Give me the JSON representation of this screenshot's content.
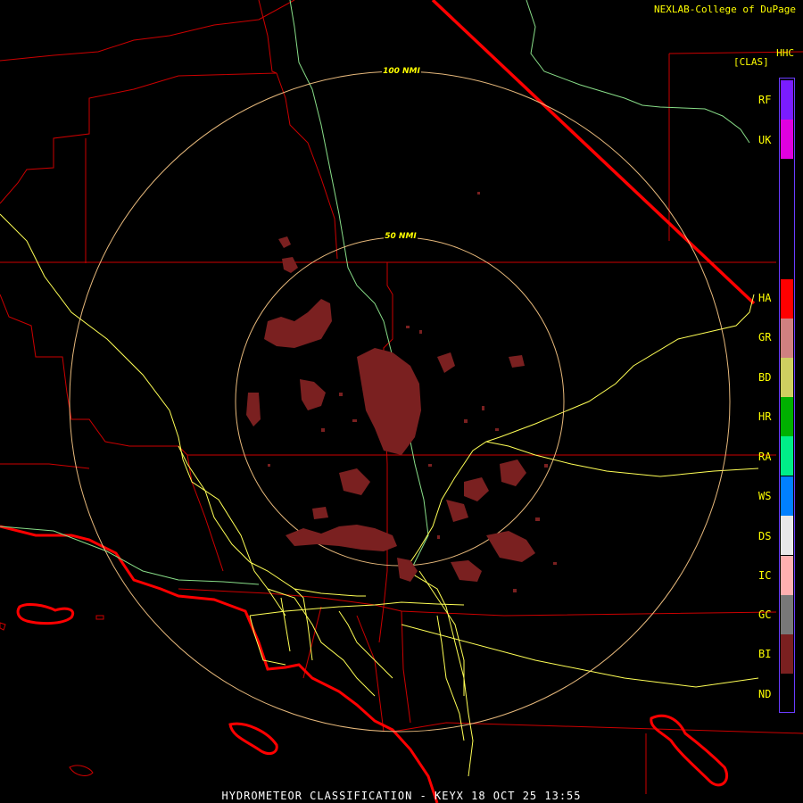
{
  "credit": "NEXLAB-College of DuPage",
  "product": {
    "code": "HHC",
    "sub": "[CLAS]"
  },
  "footer": "HYDROMETEOR CLASSIFICATION - KEYX 18 OCT 25 13:55",
  "rings": [
    {
      "label": "50 NMI"
    },
    {
      "label": "100 NMI"
    }
  ],
  "legend": [
    {
      "code": "RF",
      "color": "#7a1cff"
    },
    {
      "code": "UK",
      "color": "#e000e0"
    },
    {
      "code": "HA",
      "color": "#ff0000"
    },
    {
      "code": "GR",
      "color": "#d08080"
    },
    {
      "code": "BD",
      "color": "#cfcf60"
    },
    {
      "code": "HR",
      "color": "#00b000"
    },
    {
      "code": "RA",
      "color": "#00ee88"
    },
    {
      "code": "WS",
      "color": "#0080ff"
    },
    {
      "code": "DS",
      "color": "#e8e8e8"
    },
    {
      "code": "IC",
      "color": "#ffb0b0"
    },
    {
      "code": "GC",
      "color": "#787878"
    },
    {
      "code": "BI",
      "color": "#7a2020"
    },
    {
      "code": "ND",
      "color": "#000000"
    }
  ],
  "colors": {
    "county_lines": "#cc0000",
    "state_lines": "#ff0000",
    "highways": "#ffff55",
    "rivers": "#88dd88",
    "range_rings": "#ffcc88",
    "echo": "#7a2020"
  }
}
